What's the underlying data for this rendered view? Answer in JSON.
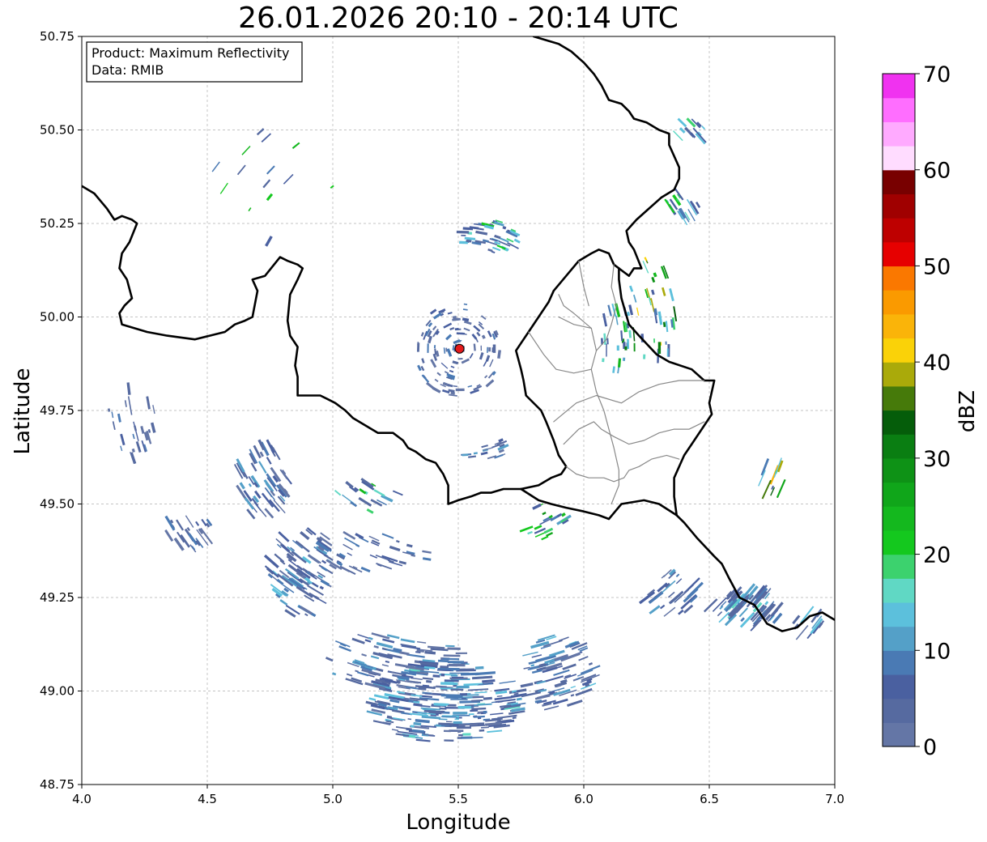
{
  "title": "26.01.2026 20:10 - 20:14 UTC",
  "info_box": {
    "product": "Product: Maximum Reflectivity",
    "data": "Data: RMIB"
  },
  "axes": {
    "xlabel": "Longitude",
    "ylabel": "Latitude",
    "xticks": [
      "4.0",
      "4.5",
      "5.0",
      "5.5",
      "6.0",
      "6.5",
      "7.0"
    ],
    "yticks": [
      "48.75",
      "49.00",
      "49.25",
      "49.50",
      "49.75",
      "50.00",
      "50.25",
      "50.50",
      "50.75"
    ],
    "xlim": [
      4.0,
      7.0
    ],
    "ylim": [
      48.75,
      50.75
    ],
    "grid": true
  },
  "radar_site": {
    "lon": 5.505,
    "lat": 49.915,
    "color": "#e31a1c"
  },
  "colorbar": {
    "label": "dBZ",
    "ticks": [
      "0",
      "10",
      "20",
      "30",
      "40",
      "50",
      "60",
      "70"
    ],
    "range": [
      0,
      70
    ],
    "step": 2.5,
    "colors": [
      "#6476a6",
      "#566aa0",
      "#4a60a0",
      "#4a7ab4",
      "#54a0c8",
      "#5cc0dc",
      "#60d8c4",
      "#3cd26e",
      "#14c81e",
      "#14b81e",
      "#10a61a",
      "#0e9216",
      "#0a7e12",
      "#055d0a",
      "#467a0a",
      "#aaaa0a",
      "#fad208",
      "#fab409",
      "#fa9a00",
      "#fa7800",
      "#e60000",
      "#be0000",
      "#a00000",
      "#780000",
      "#ffdcff",
      "#ffaaff",
      "#ff6eff",
      "#f032f0"
    ]
  },
  "chart_data": {
    "type": "heatmap",
    "title": "26.01.2026 20:10 - 20:14 UTC",
    "xlabel": "Longitude",
    "ylabel": "Latitude",
    "xlim": [
      4.0,
      7.0
    ],
    "ylim": [
      48.75,
      50.75
    ],
    "colorbar_label": "dBZ",
    "colorbar_range": [
      0,
      70
    ],
    "echo_clusters": [
      {
        "lon": 5.45,
        "lat": 48.97,
        "rx": 0.3,
        "ry": 0.11,
        "n": 260,
        "vmax": 16
      },
      {
        "lon": 5.9,
        "lat": 49.05,
        "rx": 0.14,
        "ry": 0.1,
        "n": 80,
        "vmax": 14
      },
      {
        "lon": 5.25,
        "lat": 49.08,
        "rx": 0.28,
        "ry": 0.08,
        "n": 90,
        "vmax": 12
      },
      {
        "lon": 4.87,
        "lat": 49.32,
        "rx": 0.12,
        "ry": 0.12,
        "n": 80,
        "vmax": 14
      },
      {
        "lon": 4.72,
        "lat": 49.56,
        "rx": 0.1,
        "ry": 0.1,
        "n": 55,
        "vmax": 12
      },
      {
        "lon": 4.43,
        "lat": 49.42,
        "rx": 0.1,
        "ry": 0.05,
        "n": 25,
        "vmax": 10
      },
      {
        "lon": 4.2,
        "lat": 49.72,
        "rx": 0.1,
        "ry": 0.1,
        "n": 25,
        "vmax": 10
      },
      {
        "lon": 6.65,
        "lat": 49.22,
        "rx": 0.15,
        "ry": 0.05,
        "n": 70,
        "vmax": 16
      },
      {
        "lon": 6.35,
        "lat": 49.26,
        "rx": 0.1,
        "ry": 0.06,
        "n": 30,
        "vmax": 12
      },
      {
        "lon": 5.62,
        "lat": 50.21,
        "rx": 0.12,
        "ry": 0.05,
        "n": 45,
        "vmax": 22
      },
      {
        "lon": 5.5,
        "lat": 49.91,
        "rx": 0.17,
        "ry": 0.13,
        "n": 110,
        "vmax": 10
      },
      {
        "lon": 5.1,
        "lat": 49.37,
        "rx": 0.3,
        "ry": 0.05,
        "n": 50,
        "vmax": 10
      },
      {
        "lon": 6.27,
        "lat": 50.02,
        "rx": 0.1,
        "ry": 0.16,
        "n": 40,
        "vmax": 44
      },
      {
        "lon": 6.12,
        "lat": 49.95,
        "rx": 0.06,
        "ry": 0.1,
        "n": 25,
        "vmax": 34
      },
      {
        "lon": 6.4,
        "lat": 50.3,
        "rx": 0.07,
        "ry": 0.04,
        "n": 18,
        "vmax": 30
      },
      {
        "lon": 5.85,
        "lat": 49.45,
        "rx": 0.1,
        "ry": 0.05,
        "n": 20,
        "vmax": 28
      },
      {
        "lon": 6.75,
        "lat": 49.57,
        "rx": 0.06,
        "ry": 0.04,
        "n": 10,
        "vmax": 45
      },
      {
        "lon": 6.42,
        "lat": 50.5,
        "rx": 0.06,
        "ry": 0.04,
        "n": 12,
        "vmax": 24
      },
      {
        "lon": 5.6,
        "lat": 49.65,
        "rx": 0.1,
        "ry": 0.03,
        "n": 18,
        "vmax": 12
      },
      {
        "lon": 6.9,
        "lat": 49.18,
        "rx": 0.06,
        "ry": 0.03,
        "n": 12,
        "vmax": 14
      },
      {
        "lon": 5.15,
        "lat": 49.52,
        "rx": 0.14,
        "ry": 0.04,
        "n": 18,
        "vmax": 26
      },
      {
        "lon": 4.75,
        "lat": 50.35,
        "rx": 0.25,
        "ry": 0.15,
        "n": 14,
        "vmax": 26
      }
    ],
    "borders": [
      {
        "style": "country",
        "points": [
          [
            4.0,
            50.35
          ],
          [
            4.05,
            50.33
          ],
          [
            4.1,
            50.29
          ],
          [
            4.13,
            50.26
          ],
          [
            4.16,
            50.27
          ],
          [
            4.2,
            50.26
          ],
          [
            4.22,
            50.25
          ],
          [
            4.19,
            50.2
          ],
          [
            4.16,
            50.17
          ],
          [
            4.15,
            50.13
          ],
          [
            4.18,
            50.1
          ],
          [
            4.2,
            50.05
          ],
          [
            4.17,
            50.03
          ],
          [
            4.15,
            50.01
          ],
          [
            4.16,
            49.98
          ],
          [
            4.21,
            49.97
          ],
          [
            4.26,
            49.96
          ],
          [
            4.34,
            49.95
          ],
          [
            4.45,
            49.94
          ],
          [
            4.51,
            49.95
          ],
          [
            4.57,
            49.96
          ],
          [
            4.61,
            49.98
          ],
          [
            4.65,
            49.99
          ],
          [
            4.68,
            50.0
          ],
          [
            4.7,
            50.07
          ],
          [
            4.68,
            50.1
          ],
          [
            4.73,
            50.11
          ],
          [
            4.79,
            50.16
          ],
          [
            4.82,
            50.15
          ],
          [
            4.86,
            50.14
          ],
          [
            4.88,
            50.13
          ],
          [
            4.86,
            50.1
          ],
          [
            4.83,
            50.06
          ],
          [
            4.82,
            49.99
          ],
          [
            4.83,
            49.95
          ],
          [
            4.86,
            49.92
          ],
          [
            4.85,
            49.87
          ],
          [
            4.86,
            49.84
          ],
          [
            4.86,
            49.79
          ],
          [
            4.89,
            49.79
          ],
          [
            4.95,
            49.79
          ],
          [
            4.98,
            49.78
          ],
          [
            5.01,
            49.77
          ],
          [
            5.05,
            49.75
          ],
          [
            5.08,
            49.73
          ],
          [
            5.13,
            49.71
          ],
          [
            5.18,
            49.69
          ],
          [
            5.24,
            49.69
          ],
          [
            5.28,
            49.67
          ],
          [
            5.3,
            49.65
          ],
          [
            5.33,
            49.64
          ],
          [
            5.37,
            49.62
          ],
          [
            5.41,
            49.61
          ],
          [
            5.44,
            49.58
          ],
          [
            5.46,
            49.55
          ],
          [
            5.46,
            49.5
          ],
          [
            5.5,
            49.51
          ],
          [
            5.55,
            49.52
          ],
          [
            5.59,
            49.53
          ],
          [
            5.63,
            49.53
          ],
          [
            5.68,
            49.54
          ],
          [
            5.75,
            49.54
          ],
          [
            5.82,
            49.55
          ],
          [
            5.87,
            49.57
          ],
          [
            5.91,
            49.58
          ],
          [
            5.93,
            49.6
          ],
          [
            5.9,
            49.63
          ],
          [
            5.88,
            49.67
          ],
          [
            5.85,
            49.72
          ],
          [
            5.83,
            49.75
          ],
          [
            5.77,
            49.79
          ],
          [
            5.76,
            49.83
          ],
          [
            5.75,
            49.86
          ],
          [
            5.73,
            49.91
          ],
          [
            5.75,
            49.93
          ],
          [
            5.78,
            49.96
          ],
          [
            5.82,
            50.0
          ],
          [
            5.86,
            50.04
          ],
          [
            5.88,
            50.07
          ],
          [
            5.93,
            50.11
          ],
          [
            5.98,
            50.15
          ],
          [
            6.03,
            50.17
          ],
          [
            6.06,
            50.18
          ],
          [
            6.1,
            50.17
          ],
          [
            6.12,
            50.14
          ],
          [
            6.14,
            50.13
          ],
          [
            6.16,
            50.12
          ],
          [
            6.18,
            50.11
          ],
          [
            6.2,
            50.13
          ],
          [
            6.23,
            50.13
          ],
          [
            6.2,
            50.18
          ],
          [
            6.18,
            50.2
          ],
          [
            6.17,
            50.23
          ],
          [
            6.21,
            50.26
          ],
          [
            6.26,
            50.29
          ],
          [
            6.31,
            50.32
          ],
          [
            6.36,
            50.34
          ],
          [
            6.38,
            50.37
          ],
          [
            6.38,
            50.4
          ],
          [
            6.36,
            50.43
          ],
          [
            6.34,
            50.46
          ],
          [
            6.34,
            50.49
          ],
          [
            6.3,
            50.5
          ],
          [
            6.25,
            50.52
          ],
          [
            6.2,
            50.53
          ],
          [
            6.18,
            50.55
          ],
          [
            6.15,
            50.57
          ],
          [
            6.1,
            50.58
          ],
          [
            6.07,
            50.62
          ],
          [
            6.04,
            50.65
          ],
          [
            6.0,
            50.68
          ],
          [
            5.95,
            50.71
          ],
          [
            5.9,
            50.73
          ],
          [
            5.85,
            50.74
          ],
          [
            5.8,
            50.75
          ]
        ]
      },
      {
        "style": "country",
        "points": [
          [
            5.75,
            49.54
          ],
          [
            5.82,
            49.51
          ],
          [
            5.87,
            49.5
          ],
          [
            5.93,
            49.49
          ],
          [
            6.0,
            49.48
          ],
          [
            6.06,
            49.47
          ],
          [
            6.1,
            49.46
          ],
          [
            6.15,
            49.5
          ],
          [
            6.24,
            49.51
          ],
          [
            6.3,
            49.5
          ],
          [
            6.37,
            49.47
          ],
          [
            6.4,
            49.45
          ],
          [
            6.45,
            49.41
          ],
          [
            6.52,
            49.36
          ],
          [
            6.55,
            49.34
          ],
          [
            6.58,
            49.3
          ],
          [
            6.62,
            49.25
          ],
          [
            6.68,
            49.23
          ],
          [
            6.73,
            49.18
          ],
          [
            6.79,
            49.16
          ],
          [
            6.85,
            49.17
          ],
          [
            6.9,
            49.2
          ],
          [
            6.95,
            49.21
          ],
          [
            7.0,
            49.19
          ]
        ]
      },
      {
        "style": "country",
        "points": [
          [
            6.37,
            49.47
          ],
          [
            6.36,
            49.52
          ],
          [
            6.36,
            49.57
          ],
          [
            6.4,
            49.63
          ],
          [
            6.43,
            49.66
          ],
          [
            6.48,
            49.71
          ],
          [
            6.51,
            49.74
          ],
          [
            6.5,
            49.77
          ],
          [
            6.51,
            49.8
          ],
          [
            6.52,
            49.83
          ],
          [
            6.48,
            49.83
          ],
          [
            6.43,
            49.86
          ],
          [
            6.34,
            49.88
          ],
          [
            6.29,
            49.9
          ],
          [
            6.22,
            49.95
          ],
          [
            6.18,
            49.98
          ],
          [
            6.15,
            50.05
          ],
          [
            6.14,
            50.1
          ],
          [
            6.14,
            50.13
          ]
        ]
      },
      {
        "style": "region",
        "points": [
          [
            5.93,
            49.6
          ],
          [
            5.97,
            49.58
          ],
          [
            6.02,
            49.57
          ],
          [
            6.08,
            49.57
          ],
          [
            6.12,
            49.56
          ],
          [
            6.16,
            49.57
          ],
          [
            6.18,
            49.59
          ],
          [
            6.22,
            49.6
          ],
          [
            6.27,
            49.62
          ],
          [
            6.33,
            49.63
          ],
          [
            6.38,
            49.62
          ]
        ]
      },
      {
        "style": "region",
        "points": [
          [
            5.92,
            49.66
          ],
          [
            5.98,
            49.7
          ],
          [
            6.04,
            49.72
          ],
          [
            6.07,
            49.7
          ],
          [
            6.12,
            49.68
          ],
          [
            6.18,
            49.66
          ],
          [
            6.24,
            49.67
          ],
          [
            6.3,
            49.69
          ],
          [
            6.36,
            49.7
          ],
          [
            6.42,
            49.7
          ],
          [
            6.48,
            49.72
          ]
        ]
      },
      {
        "style": "region",
        "points": [
          [
            5.88,
            49.72
          ],
          [
            5.97,
            49.77
          ],
          [
            6.05,
            49.79
          ],
          [
            6.15,
            49.77
          ],
          [
            6.22,
            49.8
          ],
          [
            6.3,
            49.82
          ],
          [
            6.38,
            49.83
          ],
          [
            6.48,
            49.83
          ]
        ]
      },
      {
        "style": "region",
        "points": [
          [
            5.9,
            50.0
          ],
          [
            5.96,
            49.98
          ],
          [
            6.03,
            49.97
          ],
          [
            6.05,
            49.91
          ],
          [
            6.03,
            49.86
          ],
          [
            6.05,
            49.8
          ],
          [
            6.08,
            49.75
          ],
          [
            6.1,
            49.7
          ],
          [
            6.12,
            49.65
          ],
          [
            6.14,
            49.59
          ],
          [
            6.14,
            49.55
          ],
          [
            6.11,
            49.5
          ]
        ]
      },
      {
        "style": "region",
        "points": [
          [
            5.78,
            49.96
          ],
          [
            5.84,
            49.9
          ],
          [
            5.89,
            49.86
          ],
          [
            5.96,
            49.85
          ],
          [
            6.03,
            49.86
          ]
        ]
      },
      {
        "style": "region",
        "points": [
          [
            6.05,
            49.91
          ],
          [
            6.09,
            49.94
          ],
          [
            6.11,
            49.98
          ],
          [
            6.13,
            50.03
          ],
          [
            6.11,
            50.08
          ],
          [
            6.12,
            50.14
          ]
        ]
      },
      {
        "style": "region",
        "points": [
          [
            5.9,
            50.06
          ],
          [
            5.92,
            50.03
          ],
          [
            5.96,
            50.01
          ],
          [
            6.03,
            49.97
          ]
        ]
      },
      {
        "style": "region",
        "points": [
          [
            5.98,
            50.15
          ],
          [
            6.0,
            50.08
          ],
          [
            6.02,
            50.03
          ]
        ]
      }
    ]
  }
}
